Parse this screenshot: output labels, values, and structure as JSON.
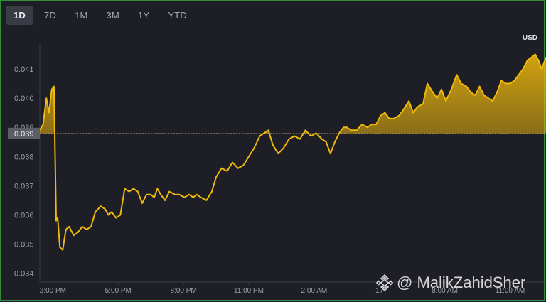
{
  "tabs": [
    {
      "label": "1D",
      "active": true
    },
    {
      "label": "7D",
      "active": false
    },
    {
      "label": "1M",
      "active": false
    },
    {
      "label": "3M",
      "active": false
    },
    {
      "label": "1Y",
      "active": false
    },
    {
      "label": "YTD",
      "active": false
    }
  ],
  "watermark": {
    "text": "@ MalikZahidSher"
  },
  "colors": {
    "line": "#f0b90b",
    "background": "#1e1f26",
    "reference": "#8a8d96"
  },
  "chart_data": {
    "type": "area",
    "currency": "USD",
    "current_price_label": "0.039",
    "reference_price": 0.03879,
    "ylim": [
      0.0337,
      0.0419
    ],
    "xlim": [
      13.4,
      36.65
    ],
    "y_ticks": [
      0.034,
      0.035,
      0.036,
      0.037,
      0.038,
      0.039,
      0.04,
      0.041
    ],
    "y_tick_labels": [
      "0.034",
      "0.035",
      "0.036",
      "0.037",
      "0.038",
      "0.039",
      "0.040",
      "0.041"
    ],
    "x_ticks": [
      14,
      17,
      20,
      23,
      26,
      29,
      32,
      35
    ],
    "x_tick_labels": [
      "2:00 PM",
      "5:00 PM",
      "8:00 PM",
      "11:00 PM",
      "2:00 AM",
      "17",
      "8:00 AM",
      "11:00 AM"
    ],
    "grid": false,
    "x_hours": [
      13.4,
      13.55,
      13.7,
      13.82,
      13.95,
      14.05,
      14.15,
      14.22,
      14.32,
      14.45,
      14.6,
      14.75,
      14.95,
      15.15,
      15.35,
      15.55,
      15.75,
      15.95,
      16.2,
      16.4,
      16.55,
      16.7,
      16.9,
      17.1,
      17.3,
      17.5,
      17.7,
      17.9,
      18.1,
      18.3,
      18.5,
      18.65,
      18.8,
      18.95,
      19.15,
      19.35,
      19.6,
      19.8,
      20.05,
      20.25,
      20.45,
      20.6,
      20.8,
      21.05,
      21.3,
      21.5,
      21.75,
      22.0,
      22.25,
      22.5,
      22.75,
      23.0,
      23.25,
      23.5,
      23.7,
      23.9,
      24.1,
      24.35,
      24.6,
      24.85,
      25.1,
      25.35,
      25.6,
      25.85,
      26.1,
      26.35,
      26.55,
      26.75,
      26.95,
      27.15,
      27.35,
      27.5,
      27.7,
      27.95,
      28.2,
      28.45,
      28.65,
      28.85,
      29.05,
      29.25,
      29.45,
      29.65,
      29.9,
      30.1,
      30.35,
      30.55,
      30.75,
      31.0,
      31.2,
      31.45,
      31.65,
      31.85,
      32.05,
      32.3,
      32.55,
      32.75,
      33.0,
      33.2,
      33.4,
      33.6,
      33.8,
      34.0,
      34.2,
      34.4,
      34.6,
      34.8,
      35.0,
      35.2,
      35.4,
      35.6,
      35.8,
      36.0,
      36.15,
      36.3,
      36.45,
      36.65
    ],
    "values": [
      0.0389,
      0.0391,
      0.04,
      0.0395,
      0.0403,
      0.0404,
      0.0358,
      0.0359,
      0.0349,
      0.0348,
      0.0355,
      0.0356,
      0.0353,
      0.0354,
      0.0356,
      0.0355,
      0.0356,
      0.0361,
      0.0363,
      0.0362,
      0.036,
      0.0361,
      0.0359,
      0.036,
      0.0369,
      0.0368,
      0.0369,
      0.0368,
      0.0364,
      0.0367,
      0.0367,
      0.0366,
      0.0369,
      0.0367,
      0.0365,
      0.0368,
      0.0367,
      0.0367,
      0.0366,
      0.0367,
      0.0366,
      0.0367,
      0.0366,
      0.0365,
      0.0368,
      0.0373,
      0.0376,
      0.0375,
      0.0378,
      0.0376,
      0.0377,
      0.038,
      0.0383,
      0.0387,
      0.0388,
      0.0389,
      0.0384,
      0.0381,
      0.0383,
      0.0386,
      0.0387,
      0.0386,
      0.0389,
      0.0387,
      0.0388,
      0.0386,
      0.0385,
      0.0381,
      0.0385,
      0.0388,
      0.039,
      0.039,
      0.0389,
      0.0389,
      0.0391,
      0.039,
      0.0391,
      0.0391,
      0.0394,
      0.0395,
      0.0393,
      0.0393,
      0.0394,
      0.0396,
      0.0399,
      0.0395,
      0.0397,
      0.0398,
      0.0405,
      0.0402,
      0.04,
      0.0403,
      0.0399,
      0.0403,
      0.0408,
      0.0405,
      0.0404,
      0.0402,
      0.0401,
      0.0404,
      0.0401,
      0.04,
      0.0399,
      0.0402,
      0.0406,
      0.0405,
      0.0405,
      0.0406,
      0.0408,
      0.041,
      0.0413,
      0.0414,
      0.0415,
      0.0413,
      0.041,
      0.0414
    ]
  }
}
